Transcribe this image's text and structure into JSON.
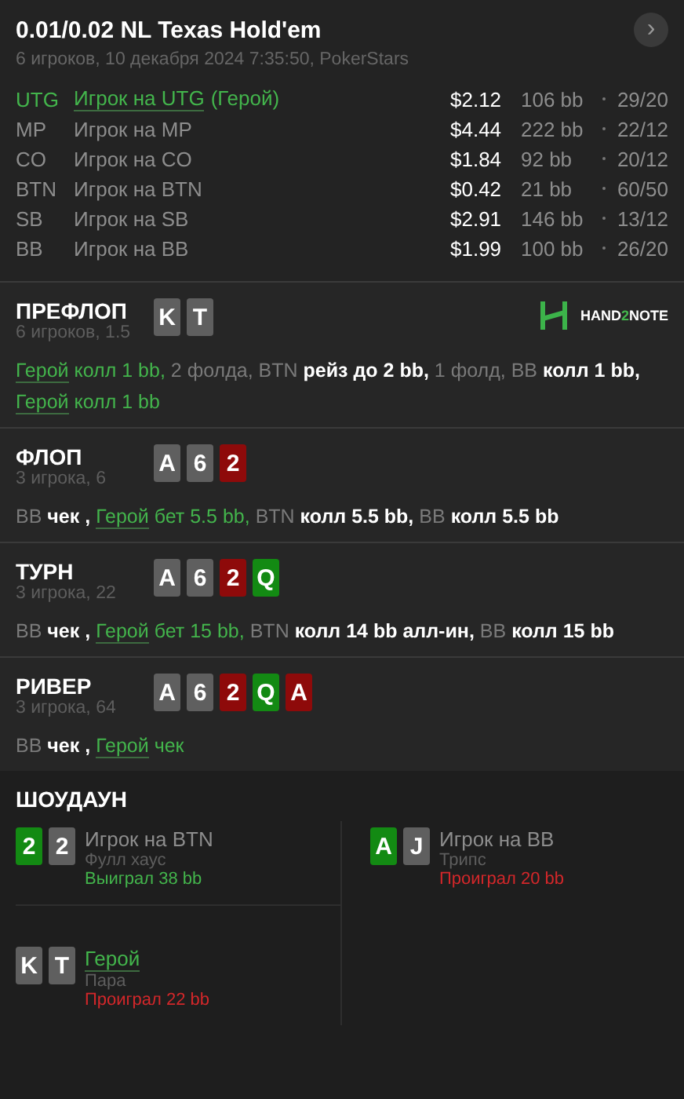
{
  "header": {
    "title": "0.01/0.02 NL Texas Hold'em",
    "subtitle": "6 игроков, 10 декабря 2024 7:35:50, PokerStars",
    "next_icon": "›"
  },
  "players": [
    {
      "position": "UTG",
      "name": "Игрок на UTG",
      "hero": true,
      "hero_tag": "(Герой)",
      "stack": "$2.12",
      "bb": "106 bb",
      "stats": "29/20"
    },
    {
      "position": "MP",
      "name": "Игрок на MP",
      "hero": false,
      "stack": "$4.44",
      "bb": "222 bb",
      "stats": "22/12"
    },
    {
      "position": "CO",
      "name": "Игрок на CO",
      "hero": false,
      "stack": "$1.84",
      "bb": "92 bb",
      "stats": "20/12"
    },
    {
      "position": "BTN",
      "name": "Игрок на BTN",
      "hero": false,
      "stack": "$0.42",
      "bb": "21 bb",
      "stats": "60/50"
    },
    {
      "position": "SB",
      "name": "Игрок на SB",
      "hero": false,
      "stack": "$2.91",
      "bb": "146 bb",
      "stats": "13/12"
    },
    {
      "position": "BB",
      "name": "Игрок на BB",
      "hero": false,
      "stack": "$1.99",
      "bb": "100 bb",
      "stats": "26/20"
    }
  ],
  "streets": [
    {
      "name": "ПРЕФЛОП",
      "info": "6 игроков, 1.5",
      "logo": {
        "left": "HAND",
        "mid": "2",
        "right": "NOTE"
      },
      "cards": [
        {
          "rank": "K",
          "color": "#5f5f5f"
        },
        {
          "rank": "T",
          "color": "#5f5f5f"
        }
      ],
      "actions": [
        {
          "kind": "hero",
          "text": "Герой"
        },
        {
          "kind": "hero_action",
          "text": "колл 1 bb,"
        },
        {
          "kind": "dim",
          "text": "2 фолда, BTN"
        },
        {
          "kind": "action",
          "text": "рейз до 2 bb,"
        },
        {
          "kind": "dim",
          "text": "1 фолд, BB"
        },
        {
          "kind": "action",
          "text": "колл 1 bb,"
        },
        {
          "kind": "hero",
          "text": "Герой"
        },
        {
          "kind": "hero_action",
          "text": "колл 1 bb"
        }
      ]
    },
    {
      "name": "ФЛОП",
      "info": "3 игрока, 6",
      "cards": [
        {
          "rank": "A",
          "color": "#5f5f5f"
        },
        {
          "rank": "6",
          "color": "#5f5f5f"
        },
        {
          "rank": "2",
          "color": "#8e0a0a"
        }
      ],
      "actions": [
        {
          "kind": "dim",
          "text": "BB"
        },
        {
          "kind": "action",
          "text": "чек ,"
        },
        {
          "kind": "hero",
          "text": "Герой"
        },
        {
          "kind": "hero_action",
          "text": "бет 5.5 bb,"
        },
        {
          "kind": "dim",
          "text": "BTN"
        },
        {
          "kind": "action",
          "text": "колл 5.5 bb,"
        },
        {
          "kind": "dim",
          "text": "BB"
        },
        {
          "kind": "action",
          "text": "колл 5.5 bb"
        }
      ]
    },
    {
      "name": "ТУРН",
      "info": "3 игрока, 22",
      "cards": [
        {
          "rank": "A",
          "color": "#5f5f5f"
        },
        {
          "rank": "6",
          "color": "#5f5f5f"
        },
        {
          "rank": "2",
          "color": "#8e0a0a"
        },
        {
          "rank": "Q",
          "color": "#138a13"
        }
      ],
      "actions": [
        {
          "kind": "dim",
          "text": "BB"
        },
        {
          "kind": "action",
          "text": "чек ,"
        },
        {
          "kind": "hero",
          "text": "Герой"
        },
        {
          "kind": "hero_action",
          "text": "бет 15 bb,"
        },
        {
          "kind": "dim",
          "text": "BTN"
        },
        {
          "kind": "action",
          "text": "колл 14 bb алл-ин,"
        },
        {
          "kind": "dim",
          "text": "BB"
        },
        {
          "kind": "action",
          "text": "колл 15 bb"
        }
      ]
    },
    {
      "name": "РИВЕР",
      "info": "3 игрока, 64",
      "cards": [
        {
          "rank": "A",
          "color": "#5f5f5f"
        },
        {
          "rank": "6",
          "color": "#5f5f5f"
        },
        {
          "rank": "2",
          "color": "#8e0a0a"
        },
        {
          "rank": "Q",
          "color": "#138a13"
        },
        {
          "rank": "A",
          "color": "#8e0a0a"
        }
      ],
      "actions": [
        {
          "kind": "dim",
          "text": "BB"
        },
        {
          "kind": "action",
          "text": "чек ,"
        },
        {
          "kind": "hero",
          "text": "Герой"
        },
        {
          "kind": "hero_action",
          "text": "чек"
        }
      ]
    }
  ],
  "showdown": {
    "title": "ШОУДАУН",
    "entries": [
      {
        "cards": [
          {
            "rank": "2",
            "color": "#138a13"
          },
          {
            "rank": "2",
            "color": "#5f5f5f"
          }
        ],
        "name": "Игрок на BTN",
        "hero": false,
        "hand": "Фулл хаус",
        "result": "Выиграл 38 bb",
        "won": true
      },
      {
        "cards": [
          {
            "rank": "A",
            "color": "#138a13"
          },
          {
            "rank": "J",
            "color": "#5f5f5f"
          }
        ],
        "name": "Игрок на BB",
        "hero": false,
        "hand": "Трипс",
        "result": "Проиграл 20 bb",
        "won": false
      },
      {
        "cards": [
          {
            "rank": "K",
            "color": "#5f5f5f"
          },
          {
            "rank": "T",
            "color": "#5f5f5f"
          }
        ],
        "name": "Герой",
        "hero": true,
        "hand": "Пара",
        "result": "Проиграл 22 bb",
        "won": false
      }
    ]
  }
}
